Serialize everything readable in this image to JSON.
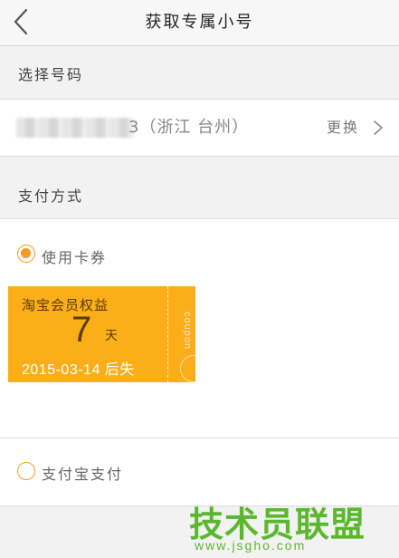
{
  "header": {
    "title": "获取专属小号",
    "back_icon": "chevron-left-icon"
  },
  "select_number": {
    "section_label": "选择号码",
    "number_tail": "3（浙江 台州）",
    "change_label": "更换",
    "change_icon": "chevron-right-icon"
  },
  "payment": {
    "section_label": "支付方式",
    "options": [
      {
        "label": "使用卡券",
        "selected": true
      },
      {
        "label": "支付宝支付",
        "selected": false
      }
    ],
    "coupon": {
      "name": "淘宝会员权益",
      "value": "7",
      "unit": "天",
      "expire": "2015-03-14 后失",
      "vertical_text": "coupon",
      "color": "#fcae1a"
    }
  },
  "watermark": {
    "text": "技术员联盟",
    "url": "www.jsgho.com",
    "color": "#5bb82e"
  },
  "colors": {
    "accent": "#f59a23",
    "background": "#f2f2f2"
  }
}
